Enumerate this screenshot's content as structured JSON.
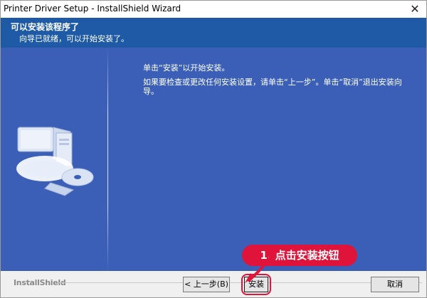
{
  "window": {
    "title": "Printer Driver Setup - InstallShield Wizard",
    "close": "✕"
  },
  "header": {
    "title": "可以安装该程序了",
    "subtitle": "向导已就绪，可以开始安装了。"
  },
  "content": {
    "line1": "单击“安装”以开始安装。",
    "line2": "如果要检查或更改任何安装设置，请单击“上一步”。单击“取消”退出安装向导。"
  },
  "footer": {
    "brand": "InstallShield",
    "back_label": "< 上一步(B)",
    "install_label": "安装",
    "cancel_label": "取消"
  },
  "annotation": {
    "text": "1. 点击安装按钮"
  },
  "colors": {
    "header_bg": "#1f5aa6",
    "content_bg": "#3b5fb6",
    "annotation": "#e0133a"
  },
  "icons": [
    "close-icon",
    "computer-cd-icon",
    "arrow-icon"
  ]
}
